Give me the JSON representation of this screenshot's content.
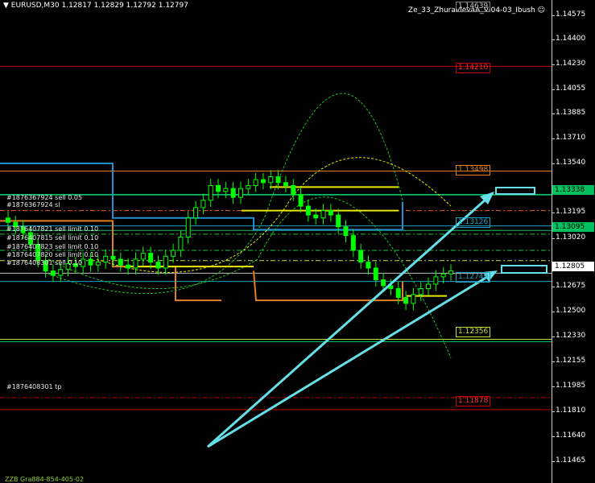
{
  "header": {
    "symbol_info": "EURUSD,M30  1.12817 1.12829 1.12792 1.12797",
    "ea_name": "Ze_33_ZhuravlevaA_V-04-03_Ibush",
    "smiley_icon": "smiley-icon"
  },
  "footer": {
    "text": "ZZB Gra884-854-405-02"
  },
  "price_axis": {
    "ticks": [
      "1.14575",
      "1.14400",
      "1.14230",
      "1.14055",
      "1.13885",
      "1.13710",
      "1.13540",
      "1.13365",
      "1.13195",
      "1.13020",
      "1.12850",
      "1.12675",
      "1.12500",
      "1.12330",
      "1.12155",
      "1.11985",
      "1.11810",
      "1.11640",
      "1.11465"
    ],
    "current_price": "1.12805",
    "green_badge_1": "1.13338",
    "green_badge_2": "1.13095",
    "colors": {
      "current_badge_bg": "#ffffff",
      "green_badge_bg": "#00c060"
    }
  },
  "levels": {
    "top_tag": "1.14639",
    "red_top": "1.14210",
    "orange_upper": "1.13498",
    "cyan_upper": "1.13126",
    "blue_lower": "1.12749",
    "green_lower": "1.12356",
    "red_bottom": "1.11878"
  },
  "orders": [
    "#1876367924 sell 0.05",
    "#1876367924 sl",
    "#1876407821 sell limit 0.10",
    "#1876407815 sell limit 0.10",
    "#1876407823 sell limit 0.10",
    "#1876407820 sell limit 0.10",
    "#1876408301 sell 0.10"
  ],
  "tp_label": "#1876408301 tp",
  "chart_data": {
    "type": "candlestick",
    "symbol": "EURUSD",
    "timeframe": "M30",
    "open": 1.12817,
    "high": 1.12829,
    "low": 1.12792,
    "close": 1.12797,
    "yrange": [
      1.1138,
      1.1466
    ],
    "close_series": [
      1.1315,
      1.1312,
      1.1308,
      1.13,
      1.1289,
      1.1282,
      1.1279,
      1.1283,
      1.1287,
      1.1285,
      1.129,
      1.1286,
      1.1288,
      1.1292,
      1.129,
      1.1286,
      1.1284,
      1.129,
      1.1294,
      1.1288,
      1.1284,
      1.1292,
      1.1296,
      1.1305,
      1.1318,
      1.1325,
      1.133,
      1.134,
      1.1336,
      1.1338,
      1.1332,
      1.1338,
      1.134,
      1.1344,
      1.1342,
      1.1346,
      1.1342,
      1.134,
      1.1334,
      1.1326,
      1.132,
      1.1318,
      1.1323,
      1.132,
      1.1312,
      1.1306,
      1.1296,
      1.1288,
      1.1284,
      1.1276,
      1.1272,
      1.127,
      1.1264,
      1.126,
      1.1266,
      1.127,
      1.1273,
      1.1278,
      1.128,
      1.1282
    ],
    "colors": {
      "candle_up": "#00ff00",
      "candle_down": "#00ff00",
      "arrow": "#66e0e8",
      "level_red": "#c80000",
      "level_orange": "#e08020",
      "level_cyan": "#20a0c0",
      "level_green": "#00c060",
      "envelope_yellow": "#e8e800",
      "envelope_green": "#20c020"
    }
  }
}
